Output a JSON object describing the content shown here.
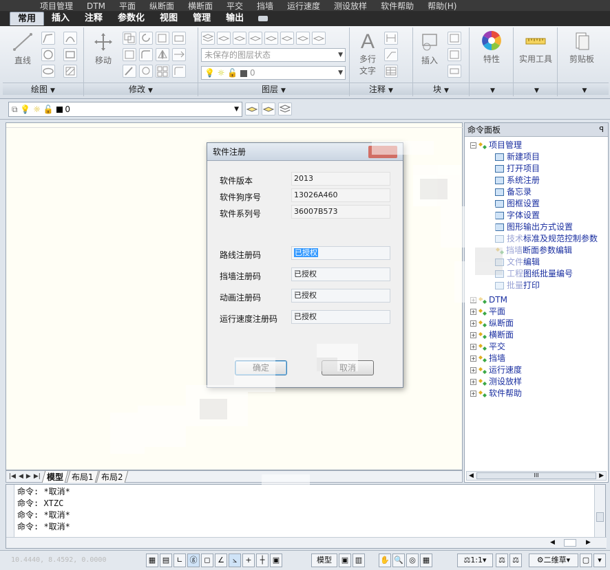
{
  "menubar": [
    "项目管理",
    "DTM",
    "平面",
    "纵断面",
    "横断面",
    "平交",
    "挡墙",
    "运行速度",
    "测设放样",
    "软件帮助",
    "帮助(H)"
  ],
  "ribbon_tabs": [
    {
      "label": "常用",
      "active": true
    },
    {
      "label": "插入",
      "active": false
    },
    {
      "label": "注释",
      "active": false
    },
    {
      "label": "参数化",
      "active": false
    },
    {
      "label": "视图",
      "active": false
    },
    {
      "label": "管理",
      "active": false
    },
    {
      "label": "输出",
      "active": false
    }
  ],
  "panels": {
    "draw": {
      "title": "绘图",
      "line_label": "直线"
    },
    "modify": {
      "title": "修改",
      "move_label": "移动"
    },
    "layer": {
      "title": "图层",
      "state_combo": "未保存的图层状态",
      "layer_combo": "0"
    },
    "annotation": {
      "title": "注释",
      "multitext": "多行",
      "multitext2": "文字"
    },
    "block": {
      "title": "块",
      "insert_label": "插入"
    },
    "properties": {
      "label": "特性"
    },
    "utilities": {
      "label": "实用工具"
    },
    "clipboard": {
      "label": "剪贴板"
    }
  },
  "layerbar": {
    "current_layer": "0"
  },
  "layout_tabs": [
    {
      "label": "模型",
      "active": true
    },
    {
      "label": "布局1",
      "active": false
    },
    {
      "label": "布局2",
      "active": false
    }
  ],
  "command_panel": {
    "title": "命令面板",
    "root": "项目管理",
    "children": [
      "新建项目",
      "打开项目",
      "系统注册",
      "备忘录",
      "图框设置",
      "字体设置",
      "图形输出方式设置",
      "技术标准及规范控制参数",
      "挡墙断面参数编辑",
      "文件编辑",
      "工程图纸批量编号",
      "批量打印"
    ],
    "groups": [
      "DTM",
      "平面",
      "纵断面",
      "横断面",
      "平交",
      "挡墙",
      "运行速度",
      "测设放样",
      "软件帮助"
    ],
    "scroll_label": "III"
  },
  "dialog": {
    "title": "软件注册",
    "fields": [
      {
        "label": "软件版本",
        "value": "2013"
      },
      {
        "label": "软件狗序号",
        "value": "13026A460"
      },
      {
        "label": "软件系列号",
        "value": "36007B573"
      }
    ],
    "codes": [
      {
        "label": "路线注册码",
        "value": "已授权",
        "selected": true
      },
      {
        "label": "挡墙注册码",
        "value": "已授权",
        "selected": false
      },
      {
        "label": "动画注册码",
        "value": "已授权",
        "selected": false
      },
      {
        "label": "运行速度注册码",
        "value": "已授权",
        "selected": false
      }
    ],
    "ok": "确定",
    "cancel": "取消"
  },
  "command_history": [
    "命令: *取消*",
    "命令: XTZC",
    "命令: *取消*",
    "命令: *取消*"
  ],
  "status": {
    "coords": "10.4440, 8.4592, 0.0000",
    "model": "模型",
    "scale": "1:1",
    "workspace": "二维草"
  }
}
